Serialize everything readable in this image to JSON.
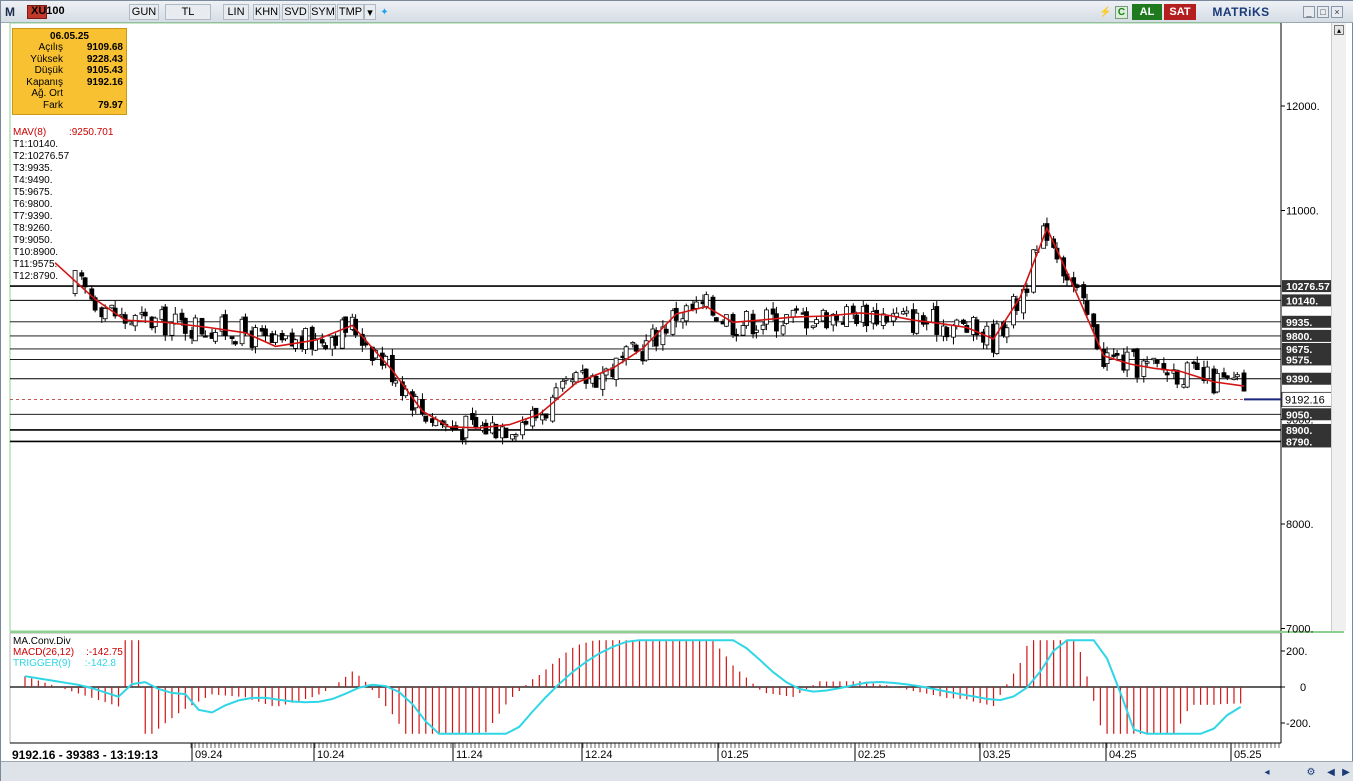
{
  "toolbar": {
    "logo": "M",
    "symbol": "XU100",
    "buttons": [
      "GUN",
      "TL",
      "LIN",
      "KHN",
      "SVD",
      "SYM",
      "TMP"
    ],
    "al_label": "AL",
    "sat_label": "SAT",
    "brand": "MATRiKS",
    "c_label": "C"
  },
  "info": {
    "date": "06.05.25",
    "rows": [
      {
        "label": "Açılış",
        "value": "9109.68"
      },
      {
        "label": "Yüksek",
        "value": "9228.43"
      },
      {
        "label": "Düşük",
        "value": "9105.43"
      },
      {
        "label": "Kapanış",
        "value": "9192.16"
      },
      {
        "label": "Ağ. Ort",
        "value": ""
      },
      {
        "label": "Fark",
        "value": "79.97"
      }
    ]
  },
  "mav": {
    "label": "MAV(8)",
    "value": ":9250.701"
  },
  "trend_labels": [
    "T1:10140.",
    "T2:10276.57",
    "T3:9935.",
    "T4:9490.",
    "T5:9675.",
    "T6:9800.",
    "T7:9390.",
    "T8:9260.",
    "T9:9050.",
    "T10:8900.",
    "T11:9575.",
    "T12:8790."
  ],
  "macd_legend": {
    "title": "MA.Conv.Div",
    "macd_label": "MACD(26,12)",
    "macd_value": ":-142.75",
    "trigger_label": "TRIGGER(9)",
    "trigger_value": ":-142.8"
  },
  "status": {
    "text": "9192.16 - 39383 - 13:19:13"
  },
  "price_axis": {
    "ticks": [
      "12000.",
      "11000.",
      "9000.",
      "8000.",
      "7000."
    ]
  },
  "level_labels": [
    "10276.57",
    "10140.",
    "9935.",
    "9800.",
    "9675.",
    "9575.",
    "9390.",
    "9050.",
    "8900.",
    "8790."
  ],
  "current_price": "9192.16",
  "macd_axis": {
    "ticks": [
      "200.",
      "0",
      "-200."
    ]
  },
  "time_axis": {
    "ticks": [
      "09.24",
      "10.24",
      "11.24",
      "12.24",
      "01.25",
      "02.25",
      "03.25",
      "04.25",
      "05.25"
    ]
  },
  "colors": {
    "mav_line": "#d21414",
    "trigger_line": "#2fd6e6",
    "macd_hist": "#d21414",
    "candle": "#000000",
    "info_bg": "#f7c132",
    "axis_label_bg": "#333333",
    "current_price_line": "#1a237e"
  },
  "chart_data": {
    "type": "candlestick",
    "price_range": [
      7000,
      12400
    ],
    "levels": [
      10276.57,
      10140,
      9935,
      9800,
      9675,
      9575,
      9390,
      9192.16,
      9050,
      8900,
      8790
    ],
    "mav_path": [
      [
        9,
        10500
      ],
      [
        21,
        10150
      ],
      [
        30,
        9950
      ],
      [
        42,
        9930
      ],
      [
        55,
        9880
      ],
      [
        66,
        9830
      ],
      [
        75,
        9700
      ],
      [
        87,
        9760
      ],
      [
        98,
        9900
      ],
      [
        110,
        9470
      ],
      [
        119,
        9080
      ],
      [
        127,
        8930
      ],
      [
        136,
        8920
      ],
      [
        145,
        8950
      ],
      [
        154,
        9050
      ],
      [
        165,
        9350
      ],
      [
        176,
        9490
      ],
      [
        185,
        9680
      ],
      [
        195,
        10010
      ],
      [
        204,
        10080
      ],
      [
        212,
        9930
      ],
      [
        220,
        9950
      ],
      [
        230,
        9980
      ],
      [
        240,
        9990
      ],
      [
        250,
        10020
      ],
      [
        258,
        10000
      ],
      [
        266,
        9950
      ],
      [
        274,
        9920
      ],
      [
        282,
        9880
      ],
      [
        290,
        9770
      ],
      [
        298,
        10170
      ],
      [
        306,
        10830
      ],
      [
        314,
        10270
      ],
      [
        323,
        9610
      ],
      [
        331,
        9530
      ],
      [
        338,
        9490
      ],
      [
        346,
        9460
      ],
      [
        356,
        9360
      ],
      [
        365,
        9320
      ]
    ],
    "time_ticks": [
      "09.24",
      "10.24",
      "11.24",
      "12.24",
      "01.25",
      "02.25",
      "03.25",
      "04.25",
      "05.25"
    ],
    "macd_range": [
      -280,
      280
    ],
    "last_macd": -142.75,
    "last_trigger": -142.8
  }
}
